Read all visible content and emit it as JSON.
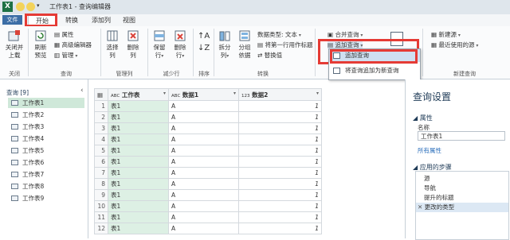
{
  "titlebar": {
    "logo": "X",
    "quick_icons": [
      "smiley-icon",
      "sad-icon",
      "down-icon"
    ],
    "title": "工作表1 - 查询编辑器"
  },
  "tabs": {
    "file": "文件",
    "items": [
      "开始",
      "转换",
      "添加列",
      "视图"
    ],
    "active": "开始"
  },
  "ribbon": {
    "close_load": [
      "关闭并",
      "上载"
    ],
    "close_group": "关闭",
    "refresh": [
      "刷新",
      "预览"
    ],
    "props": "属性",
    "adv_editor": "高级编辑器",
    "manage": "管理",
    "query_group": "查询",
    "choose_cols": [
      "选择",
      "列"
    ],
    "remove_cols": [
      "删除",
      "列"
    ],
    "manage_cols_group": "管理列",
    "keep_rows": [
      "保留",
      "行"
    ],
    "remove_rows": [
      "删除",
      "行"
    ],
    "reduce_rows_group": "减少行",
    "sort_group": "排序",
    "split_col": [
      "拆分",
      "列"
    ],
    "group_by": [
      "分组",
      "依据"
    ],
    "data_type": "数据类型: 文本",
    "first_row_header": "将第一行用作标题",
    "replace_values": "替换值",
    "transform_group": "转换",
    "merge_queries": "合并查询",
    "append_queries": "追加查询",
    "new_source": "新建源",
    "recent_sources": "最近使用的源",
    "new_query_group": "新建查询",
    "menu": {
      "item1": "追加查询",
      "item2": "将查询追加为新查询"
    }
  },
  "left_pane": {
    "header": "查询 [9]",
    "items": [
      "工作表1",
      "工作表2",
      "工作表3",
      "工作表4",
      "工作表5",
      "工作表6",
      "工作表7",
      "工作表8",
      "工作表9"
    ],
    "selected": 0
  },
  "grid": {
    "headers": [
      "工作表",
      "数据1",
      "数据2"
    ],
    "type_badges": [
      "ABC",
      "ABC",
      "123"
    ],
    "rows": [
      [
        "1",
        "表1",
        "A",
        "1"
      ],
      [
        "2",
        "表1",
        "A",
        "1"
      ],
      [
        "3",
        "表1",
        "A",
        "1"
      ],
      [
        "4",
        "表1",
        "A",
        "1"
      ],
      [
        "5",
        "表1",
        "A",
        "1"
      ],
      [
        "6",
        "表1",
        "A",
        "1"
      ],
      [
        "7",
        "表1",
        "A",
        "1"
      ],
      [
        "8",
        "表1",
        "A",
        "1"
      ],
      [
        "9",
        "表1",
        "A",
        "1"
      ],
      [
        "10",
        "表1",
        "A",
        "1"
      ],
      [
        "11",
        "表1",
        "A",
        "1"
      ],
      [
        "12",
        "表1",
        "A",
        "1"
      ]
    ]
  },
  "right_pane": {
    "title": "查询设置",
    "props_section": "属性",
    "name_label": "名称",
    "name_value": "工作表1",
    "all_props": "所有属性",
    "steps_section": "应用的步骤",
    "steps": [
      "源",
      "导航",
      "提升的标题",
      "更改的类型"
    ]
  },
  "colors": {
    "accent_red": "#e53b35",
    "excel_green": "#1e7145",
    "selected_green": "#cfe8d9",
    "menu_highlight": "#cfe0f1"
  }
}
